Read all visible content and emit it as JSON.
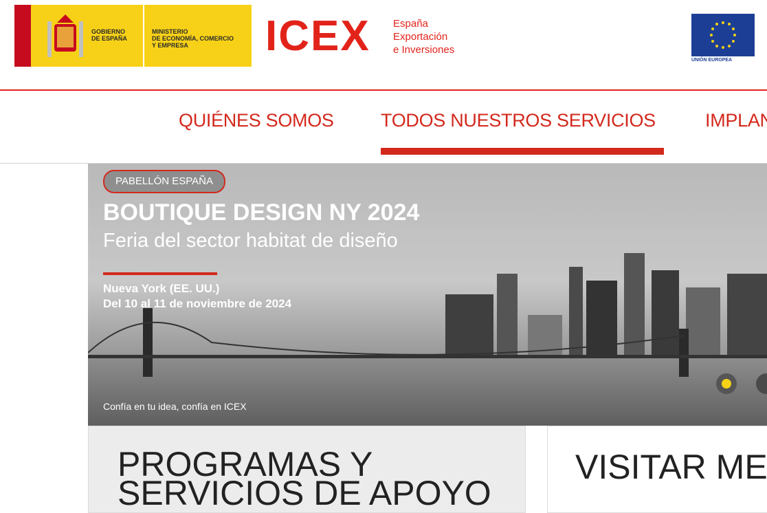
{
  "header": {
    "gov": {
      "line1": "GOBIERNO",
      "line2": "DE ESPAÑA",
      "min1": "MINISTERIO",
      "min2": "DE ECONOMÍA, COMERCIO",
      "min3": "Y EMPRESA"
    },
    "icex": {
      "wordmark": "ICEX",
      "sub1": "España",
      "sub2": "Exportación",
      "sub3": "e Inversiones"
    },
    "eu": {
      "caption": "UNIÓN EUROPEA"
    }
  },
  "nav": {
    "items": [
      {
        "label": "QUIÉNES SOMOS",
        "active": false
      },
      {
        "label": "TODOS NUESTROS SERVICIOS",
        "active": true
      },
      {
        "label": "IMPLAN"
      }
    ],
    "accent_color": "#d3281c"
  },
  "hero": {
    "badge": "PABELLÓN ESPAÑA",
    "title": "BOUTIQUE DESIGN NY 2024",
    "subtitle": "Feria del sector habitat de diseño",
    "location": "Nueva York (EE. UU.)",
    "dates": "Del 10 al 11 de noviembre de 2024",
    "slogan": "Confía en tu idea, confía en ICEX",
    "carousel": {
      "active_dot_color": "#f7d117"
    }
  },
  "cards": [
    {
      "title": "PROGRAMAS Y SERVICIOS DE APOYO"
    },
    {
      "title": "VISITAR ME"
    }
  ]
}
